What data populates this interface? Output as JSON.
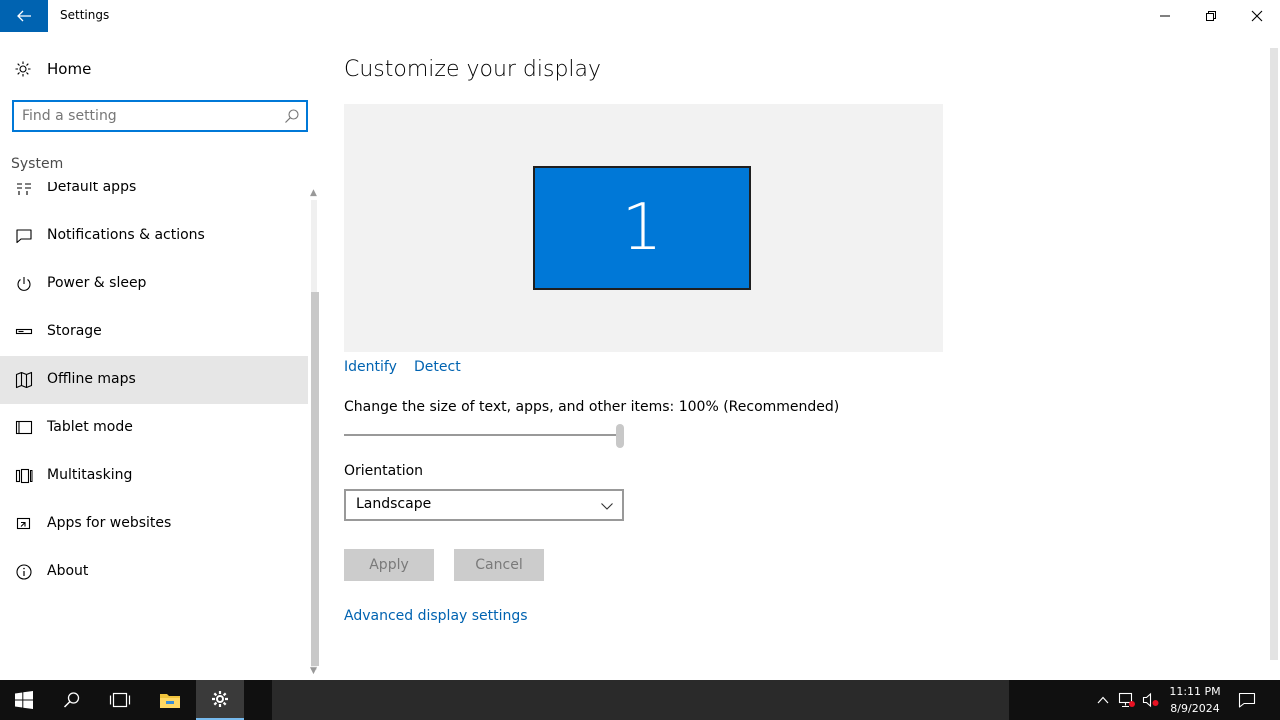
{
  "window": {
    "title": "Settings"
  },
  "nav": {
    "home_label": "Home",
    "search_placeholder": "Find a setting",
    "section_label": "System",
    "items": [
      {
        "label": "Default apps",
        "icon": "default-apps-icon"
      },
      {
        "label": "Notifications & actions",
        "icon": "notifications-icon"
      },
      {
        "label": "Power & sleep",
        "icon": "power-icon"
      },
      {
        "label": "Storage",
        "icon": "storage-icon"
      },
      {
        "label": "Offline maps",
        "icon": "map-icon",
        "active": true
      },
      {
        "label": "Tablet mode",
        "icon": "tablet-icon"
      },
      {
        "label": "Multitasking",
        "icon": "multitasking-icon"
      },
      {
        "label": "Apps for websites",
        "icon": "apps-websites-icon"
      },
      {
        "label": "About",
        "icon": "info-icon"
      }
    ]
  },
  "main": {
    "title": "Customize your display",
    "monitor_number": "1",
    "identify_link": "Identify",
    "detect_link": "Detect",
    "scale_label": "Change the size of text, apps, and other items: 100% (Recommended)",
    "scale_value_fraction": 1.0,
    "orientation_label": "Orientation",
    "orientation_value": "Landscape",
    "apply_label": "Apply",
    "cancel_label": "Cancel",
    "advanced_link": "Advanced display settings"
  },
  "taskbar": {
    "time": "11:11 PM",
    "date": "8/9/2024"
  },
  "colors": {
    "accent": "#0078d7",
    "back_button": "#0063b1",
    "link": "#0063b1",
    "taskbar": "#101010"
  }
}
